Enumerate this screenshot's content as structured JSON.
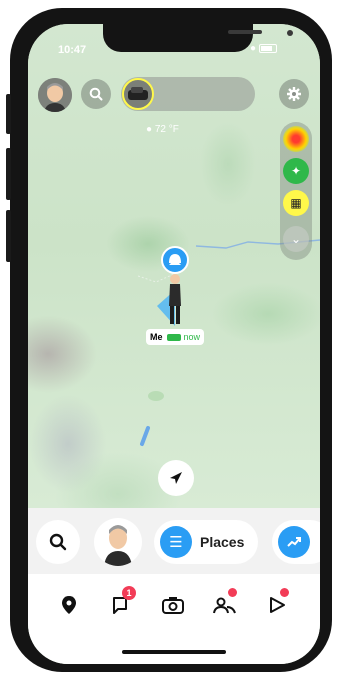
{
  "status_bar": {
    "time": "10:47"
  },
  "top_bar": {
    "icons": [
      "bitmoji-avatar",
      "search-icon",
      "friend-bitmoji",
      "settings-icon"
    ]
  },
  "weather": {
    "temperature": "72 °F"
  },
  "map_layers": {
    "icons": [
      "heatmap-icon",
      "satellite-icon",
      "memories-icon",
      "chevron-down-icon"
    ]
  },
  "me_marker": {
    "name": "Me",
    "time": "now"
  },
  "drawer": {
    "places_label": "Places"
  },
  "nav": {
    "items": [
      "map-pin-icon",
      "chat-icon",
      "camera-icon",
      "friends-icon",
      "spotlight-icon"
    ],
    "chat_badge": "1"
  },
  "colors": {
    "accent": "#2a9df4",
    "badge": "#f23c57",
    "map": "#cfe5cc",
    "highlight": "#fff84a"
  }
}
